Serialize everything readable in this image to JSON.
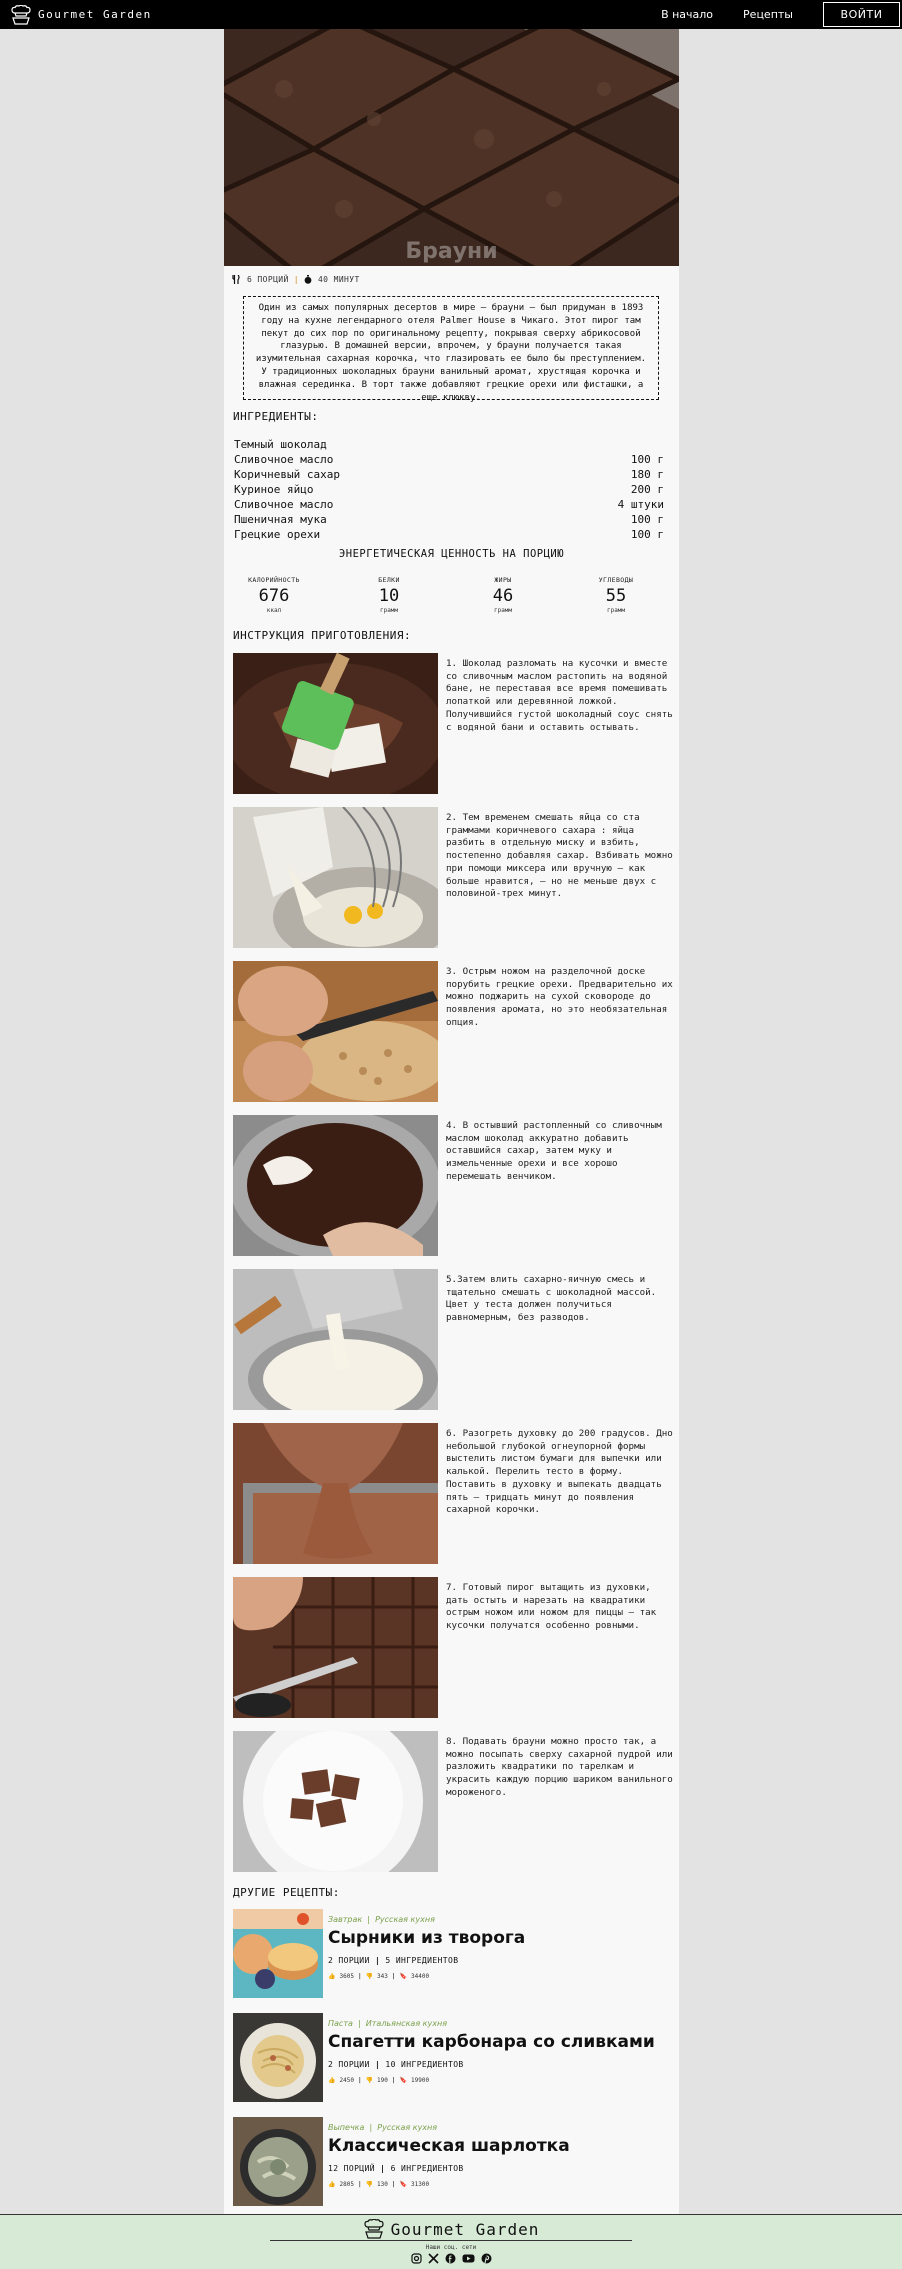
{
  "header": {
    "brand": "Gourmet Garden",
    "nav": [
      "В начало",
      "Рецепты"
    ],
    "login": "ВОЙТИ"
  },
  "hero": {
    "title": "Брауни"
  },
  "meta": {
    "servings": "6 ПОРЦИЙ",
    "time": "40 МИНУТ"
  },
  "description": "Один из самых популярных десертов в мире — брауни — был придуман в 1893 году на кухне легендарного отеля Palmer House в Чикаго. Этот пирог там пекут до сих пор по оригинальному рецепту, покрывая сверху абрикосовой глазурью. В домашней версии, впрочем, у брауни получается такая изумительная сахарная корочка, что глазировать ее было бы преступлением. У традиционных шоколадных брауни ванильный аромат, хрустящая корочка и влажная серединка. В торт также добавляют грецкие орехи или фисташки, а еще клюкву.",
  "ingredients_title": "ИНГРЕДИЕНТЫ:",
  "ingredients": [
    {
      "name": "Темный шоколад",
      "qty": ""
    },
    {
      "name": "Сливочное масло",
      "qty": "100 г"
    },
    {
      "name": "Коричневый сахар",
      "qty": "180 г"
    },
    {
      "name": "Куриное яйцо",
      "qty": "200 г"
    },
    {
      "name": "Сливочное масло",
      "qty": "4 штуки"
    },
    {
      "name": "Пшеничная мука",
      "qty": "100 г"
    },
    {
      "name": "Грецкие орехи",
      "qty": "100 г"
    }
  ],
  "nutrition_title": "ЭНЕРГЕТИЧЕСКАЯ ЦЕННОСТЬ НА ПОРЦИЮ",
  "nutrition": [
    {
      "label": "КАЛОРИЙНОСТЬ",
      "value": "676",
      "unit": "ккал"
    },
    {
      "label": "БЕЛКИ",
      "value": "10",
      "unit": "грамм"
    },
    {
      "label": "ЖИРЫ",
      "value": "46",
      "unit": "грамм"
    },
    {
      "label": "УГЛЕВОДЫ",
      "value": "55",
      "unit": "грамм"
    }
  ],
  "instructions_title": "ИНСТРУКЦИЯ ПРИГОТОВЛЕНИЯ:",
  "steps": [
    "1. Шоколад разломать на кусочки и вместе со сливочным маслом растопить на водяной бане, не переставая все время помешивать лопаткой или деревянной ложкой. Получившийся густой шоколадный соус снять с водяной бани и оставить остывать.",
    "2. Тем временем смешать яйца со ста граммами коричневого сахара : яйца разбить в отдельную миску и взбить, постепенно добавляя сахар. Взбивать можно при помощи миксера или вручную — как больше нравится, — но не меньше двух с половиной-трех минут.",
    "3. Острым ножом на разделочной доске порубить грецкие орехи. Предварительно их можно поджарить на сухой сковороде до появления аромата, но это необязательная опция.",
    "4. В остывший растопленный со сливочным маслом шоколад аккуратно добавить оставшийся сахар, затем муку и измельченные орехи и все хорошо перемешать венчиком.",
    "5.Затем влить сахарно-яичную смесь и тщательно смешать с шоколадной массой. Цвет у теста должен получиться равномерным, без разводов.",
    "6. Разогреть духовку до 200 градусов. Дно небольшой глубокой огнеупорной формы выстелить листом бумаги для выпечки или калькой. Перелить тесто в форму. Поставить в духовку и выпекать двадцать пять — тридцать минут до появления сахарной корочки.",
    "7. Готовый пирог вытащить из духовки, дать остыть и нарезать на квадратики острым ножом или ножом для пиццы — так кусочки получатся особенно ровными.",
    "8. Подавать брауни можно просто так, а можно посыпать сверху сахарной пудрой или разложить квадратики по тарелкам и украсить каждую порцию шариком ванильного мороженого."
  ],
  "other_title": "ДРУГИЕ РЕЦЕПТЫ:",
  "other_recipes": [
    {
      "category": "Завтрак",
      "cuisine": "Русская кухня",
      "title": "Сырники из творога",
      "servings": "2 ПОРЦИИ",
      "ingredients": "5 ИНГРЕДИЕНТОВ",
      "likes": "3605",
      "dislikes": "343",
      "saves": "34400"
    },
    {
      "category": "Паста",
      "cuisine": "Итальянская кухня",
      "title": "Спагетти карбонара со сливками",
      "servings": "2 ПОРЦИИ",
      "ingredients": "10 ИНГРЕДИЕНТОВ",
      "likes": "2450",
      "dislikes": "190",
      "saves": "19900"
    },
    {
      "category": "Выпечка",
      "cuisine": "Русская кухня",
      "title": "Классическая шарлотка",
      "servings": "12 ПОРЦИЙ",
      "ingredients": "6 ИНГРЕДИЕНТОВ",
      "likes": "2805",
      "dislikes": "130",
      "saves": "31300"
    }
  ],
  "footer": {
    "brand": "Gourmet Garden",
    "social_label": "Наши соц. сети"
  }
}
